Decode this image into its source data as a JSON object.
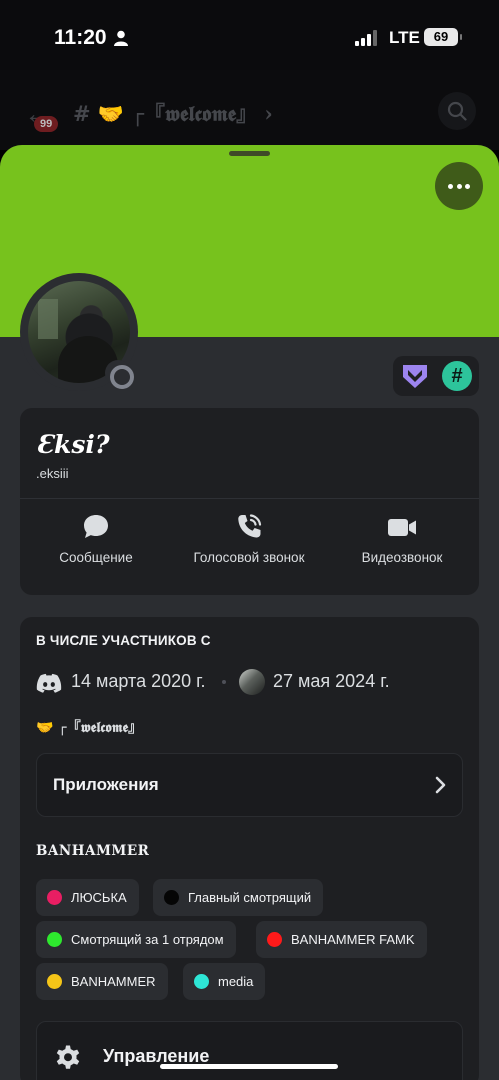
{
  "status_bar": {
    "time": "11:20",
    "network": "LTE",
    "battery": "69",
    "icons": [
      "person-icon",
      "signal-icon"
    ]
  },
  "background_header": {
    "unread_badge": "99",
    "channel_title": "# 🤝 ┌『𝖜𝖊𝖑𝖈𝖔𝖒𝖊』 ›",
    "icons": [
      "back-arrow-icon",
      "search-icon"
    ]
  },
  "profile": {
    "banner_color": "#77c21d",
    "display_name": "Ɛksi?",
    "username": ".eksiii",
    "status": "offline",
    "badge_icons": [
      "hypesquad-icon",
      "hash-badge-icon"
    ],
    "hash_badge_symbol": "#",
    "actions": [
      {
        "label": "Сообщение",
        "icon": "message-icon"
      },
      {
        "label": "Голосовой звонок",
        "icon": "phone-call-icon"
      },
      {
        "label": "Видеозвонок",
        "icon": "video-camera-icon"
      }
    ]
  },
  "membership": {
    "heading": "В ЧИСЛЕ УЧАСТНИКОВ С",
    "discord_since": "14 марта 2020 г.",
    "server_since": "27 мая 2024 г.",
    "current_channel": "🤝 ┌『𝖜𝖊𝖑𝖈𝖔𝖒𝖊』"
  },
  "apps": {
    "label": "Приложения"
  },
  "roles": {
    "heading": "BANHAMMER",
    "items": [
      {
        "name": "ЛЮСЬКА",
        "color": "#e91e63"
      },
      {
        "name": "Главный смотрящий",
        "color": "#050505"
      },
      {
        "name": "Смотрящий за 1 отрядом",
        "color": "#2ee82e"
      },
      {
        "name": "BANHAMMER FAMK",
        "color": "#ff1a1a"
      },
      {
        "name": "BANHAMMER",
        "color": "#f5c518"
      },
      {
        "name": "media",
        "color": "#2ee6d6"
      }
    ]
  },
  "manage": {
    "label": "Управление",
    "icon": "gear-icon"
  }
}
